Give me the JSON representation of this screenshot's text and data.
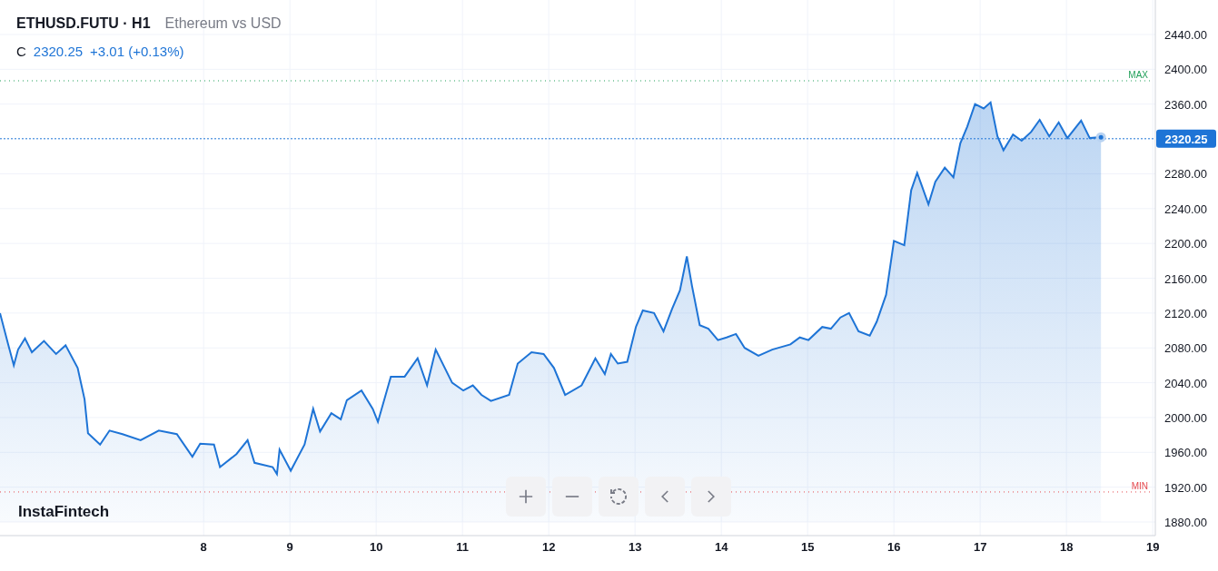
{
  "header": {
    "symbol": "ETHUSD.FUTU · H1",
    "description": "Ethereum vs USD",
    "price_label": "C",
    "price": "2320.25",
    "change": "+3.01 (+0.13%)"
  },
  "chart": {
    "chart_data": {
      "type": "area",
      "x": [
        5.64,
        5.73,
        5.8,
        5.85,
        5.93,
        6.01,
        6.15,
        6.29,
        6.4,
        6.54,
        6.62,
        6.66,
        6.8,
        6.91,
        7.06,
        7.27,
        7.48,
        7.69,
        7.87,
        7.96,
        8.12,
        8.19,
        8.38,
        8.51,
        8.59,
        8.8,
        8.85,
        8.88,
        9.01,
        9.17,
        9.27,
        9.35,
        9.48,
        9.59,
        9.66,
        9.83,
        9.96,
        10.02,
        10.17,
        10.33,
        10.48,
        10.59,
        10.69,
        10.88,
        11.01,
        11.12,
        11.22,
        11.33,
        11.54,
        11.64,
        11.8,
        11.94,
        12.06,
        12.19,
        12.38,
        12.54,
        12.65,
        12.72,
        12.8,
        12.91,
        13.01,
        13.09,
        13.22,
        13.33,
        13.43,
        13.52,
        13.6,
        13.66,
        13.75,
        13.85,
        13.96,
        14.06,
        14.17,
        14.27,
        14.43,
        14.59,
        14.8,
        14.91,
        15.01,
        15.17,
        15.27,
        15.38,
        15.48,
        15.59,
        15.72,
        15.8,
        15.91,
        16.0,
        16.12,
        16.2,
        16.27,
        16.4,
        16.48,
        16.59,
        16.69,
        16.77,
        16.85,
        16.94,
        17.04,
        17.12,
        17.2,
        17.27,
        17.38,
        17.48,
        17.59,
        17.69,
        17.8,
        17.91,
        18.01,
        18.17,
        18.27,
        18.4
      ],
      "series": [
        {
          "color": "#1e74d6",
          "values": [
            2120,
            2086,
            2060,
            2078,
            2091,
            2075,
            2088,
            2073,
            2083,
            2057,
            2021,
            1982,
            1969,
            1985,
            1981,
            1974,
            1985,
            1981,
            1955,
            1970,
            1969,
            1943,
            1958,
            1974,
            1948,
            1943,
            1935,
            1963,
            1939,
            1969,
            2010,
            1984,
            2005,
            1998,
            2020,
            2031,
            2010,
            1995,
            2047,
            2047,
            2068,
            2037,
            2078,
            2040,
            2031,
            2037,
            2026,
            2019,
            2026,
            2062,
            2075,
            2073,
            2057,
            2026,
            2037,
            2068,
            2050,
            2073,
            2062,
            2064,
            2104,
            2123,
            2120,
            2099,
            2125,
            2146,
            2185,
            2151,
            2106,
            2102,
            2089,
            2092,
            2096,
            2080,
            2071,
            2078,
            2084,
            2092,
            2089,
            2104,
            2102,
            2115,
            2120,
            2099,
            2094,
            2110,
            2141,
            2203,
            2198,
            2261,
            2281,
            2245,
            2271,
            2287,
            2276,
            2315,
            2334,
            2360,
            2355,
            2362,
            2323,
            2307,
            2325,
            2318,
            2328,
            2342,
            2323,
            2339,
            2321,
            2341,
            2321,
            2322
          ]
        }
      ],
      "xlim": [
        5.64,
        19.03
      ],
      "ylim": [
        1864.4,
        2479.6
      ],
      "xticks": [
        8,
        9,
        10,
        11,
        12,
        13,
        14,
        15,
        16,
        17,
        18,
        19
      ],
      "yticks": [
        {
          "value": 1880,
          "label": "1880.00"
        },
        {
          "value": 1920,
          "label": "1920.00"
        },
        {
          "value": 1960,
          "label": "1960.00"
        },
        {
          "value": 2000,
          "label": "2000.00"
        },
        {
          "value": 2040,
          "label": "2040.00"
        },
        {
          "value": 2080,
          "label": "2080.00"
        },
        {
          "value": 2120,
          "label": "2120.00"
        },
        {
          "value": 2160,
          "label": "2160.00"
        },
        {
          "value": 2200,
          "label": "2200.00"
        },
        {
          "value": 2240,
          "label": "2240.00"
        },
        {
          "value": 2280,
          "label": "2280.00"
        },
        {
          "value": 2360,
          "label": "2360.00"
        },
        {
          "value": 2400,
          "label": "2400.00"
        },
        {
          "value": 2440,
          "label": "2440.00"
        }
      ],
      "grid": true,
      "ref_lines": [
        {
          "axis": "y",
          "value": 2386.8,
          "label": "MAX",
          "color": "#22a05a"
        },
        {
          "axis": "y",
          "value": 1914.5,
          "label": "MIN",
          "color": "#e5484d"
        },
        {
          "axis": "y",
          "value": 2320.25,
          "label": "2320.25",
          "color": "#1e74d6"
        }
      ]
    }
  },
  "brand": "InstaFintech",
  "controls": [
    {
      "kind": "zoom-in"
    },
    {
      "kind": "zoom-out"
    },
    {
      "kind": "reset"
    },
    {
      "kind": "back"
    },
    {
      "kind": "forward"
    }
  ]
}
